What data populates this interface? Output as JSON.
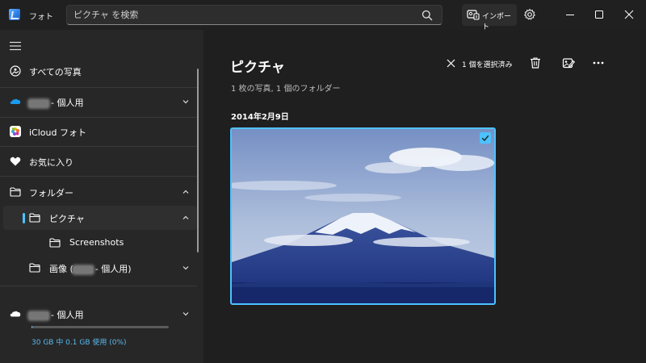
{
  "window": {
    "app_title": "フォト",
    "search_placeholder": "ピクチャ を検索",
    "import_label": "インポート"
  },
  "sidebar": {
    "items": [
      {
        "label": "すべての写真",
        "icon": "photo-icon"
      },
      {
        "label": "- 個人用",
        "icon": "onedrive-icon",
        "expandable": true
      },
      {
        "label": "iCloud フォト",
        "icon": "icloud-icon"
      },
      {
        "label": "お気に入り",
        "icon": "heart-icon"
      },
      {
        "label": "フォルダー",
        "icon": "folder-icon",
        "expanded": true
      },
      {
        "label": "ピクチャ",
        "icon": "folder-icon",
        "expanded": true,
        "selected": true
      },
      {
        "label": "Screenshots",
        "icon": "folder-icon"
      },
      {
        "label_prefix": "画像 (",
        "label_suffix": "- 個人用)",
        "icon": "folder-icon",
        "expandable": true
      }
    ],
    "storage": {
      "account_label": "- 個人用",
      "usage_text": "30 GB 中 0.1 GB 使用 (0%)",
      "usage_fraction": 0.003
    }
  },
  "main": {
    "title": "ピクチャ",
    "subtitle": "1 枚の写真, 1 個のフォルダー",
    "selection_label": "1 個を選択済み",
    "date_header": "2014年2月9日",
    "photo_selected": true
  },
  "colors": {
    "accent": "#4cc2ff",
    "background": "#202020",
    "sidebar": "#272727"
  }
}
